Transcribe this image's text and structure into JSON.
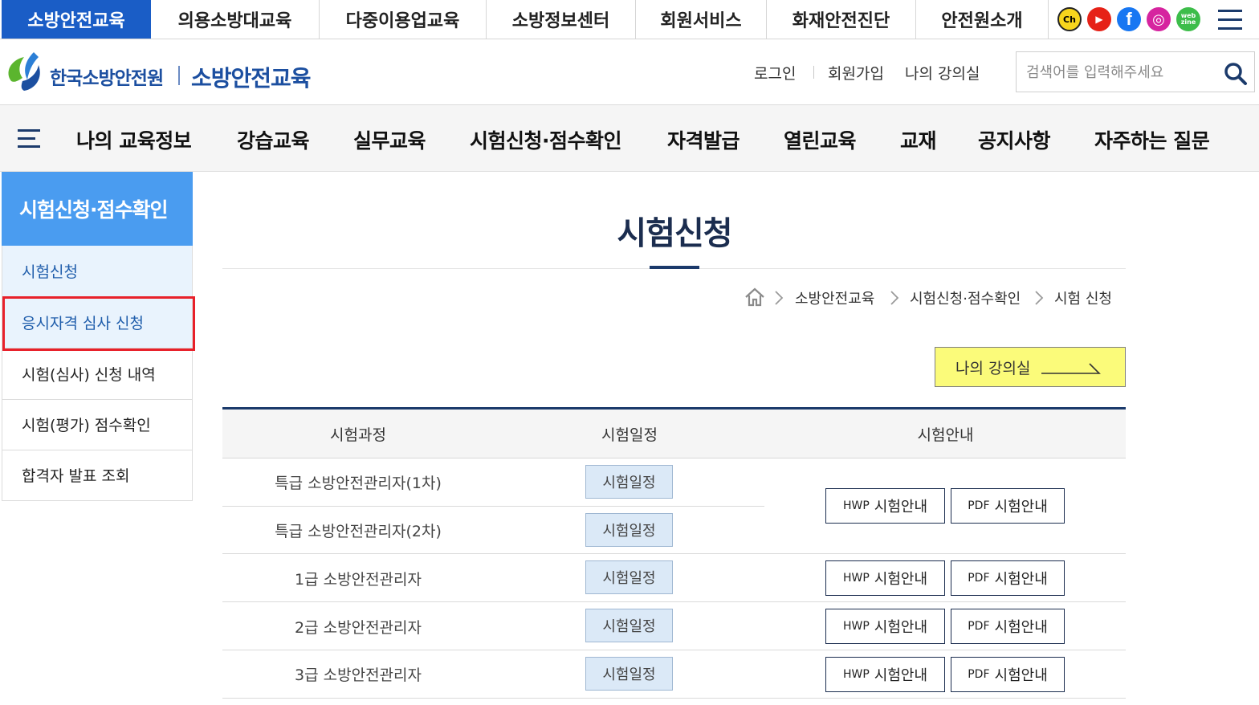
{
  "top_tabs": [
    "소방안전교육",
    "의용소방대교육",
    "다중이용업교육",
    "소방정보센터",
    "회원서비스",
    "화재안전진단",
    "안전원소개"
  ],
  "sns": [
    {
      "name": "kakao-channel-icon",
      "label": "Ch",
      "color": "#f7d51d"
    },
    {
      "name": "youtube-icon",
      "label": "▶",
      "color": "#e62117"
    },
    {
      "name": "facebook-icon",
      "label": "f",
      "color": "#1877f2"
    },
    {
      "name": "instagram-icon",
      "label": "◎",
      "color": "#d6249f"
    },
    {
      "name": "webzine-icon",
      "label": "web zine",
      "color": "#3dbd4a"
    }
  ],
  "header": {
    "org_name": "한국소방안전원",
    "site_name": "소방안전교육",
    "util_links": [
      "로그인",
      "회원가입",
      "나의 강의실"
    ],
    "search_placeholder": "검색어를 입력해주세요"
  },
  "main_nav": [
    "나의 교육정보",
    "강습교육",
    "실무교육",
    "시험신청·점수확인",
    "자격발급",
    "열린교육",
    "교재",
    "공지사항",
    "자주하는 질문"
  ],
  "sidebar": {
    "title": "시험신청·점수확인",
    "items": [
      "시험신청",
      "응시자격 심사 신청",
      "시험(심사) 신청 내역",
      "시험(평가) 점수확인",
      "합격자 발표 조회"
    ]
  },
  "page": {
    "title": "시험신청",
    "breadcrumb": [
      "소방안전교육",
      "시험신청·점수확인",
      "시험 신청"
    ],
    "my_class_button": "나의 강의실"
  },
  "table": {
    "headers": [
      "시험과정",
      "시험일정",
      "시험안내"
    ],
    "rows": [
      {
        "course": "특급 소방안전관리자(1차)",
        "schedule": "시험일정"
      },
      {
        "course": "특급 소방안전관리자(2차)",
        "schedule": "시험일정"
      },
      {
        "course": "1급 소방안전관리자",
        "schedule": "시험일정"
      },
      {
        "course": "2급 소방안전관리자",
        "schedule": "시험일정"
      },
      {
        "course": "3급 소방안전관리자",
        "schedule": "시험일정"
      }
    ],
    "guide_hwp_tag": "HWP",
    "guide_pdf_tag": "PDF",
    "guide_label": "시험안내"
  }
}
